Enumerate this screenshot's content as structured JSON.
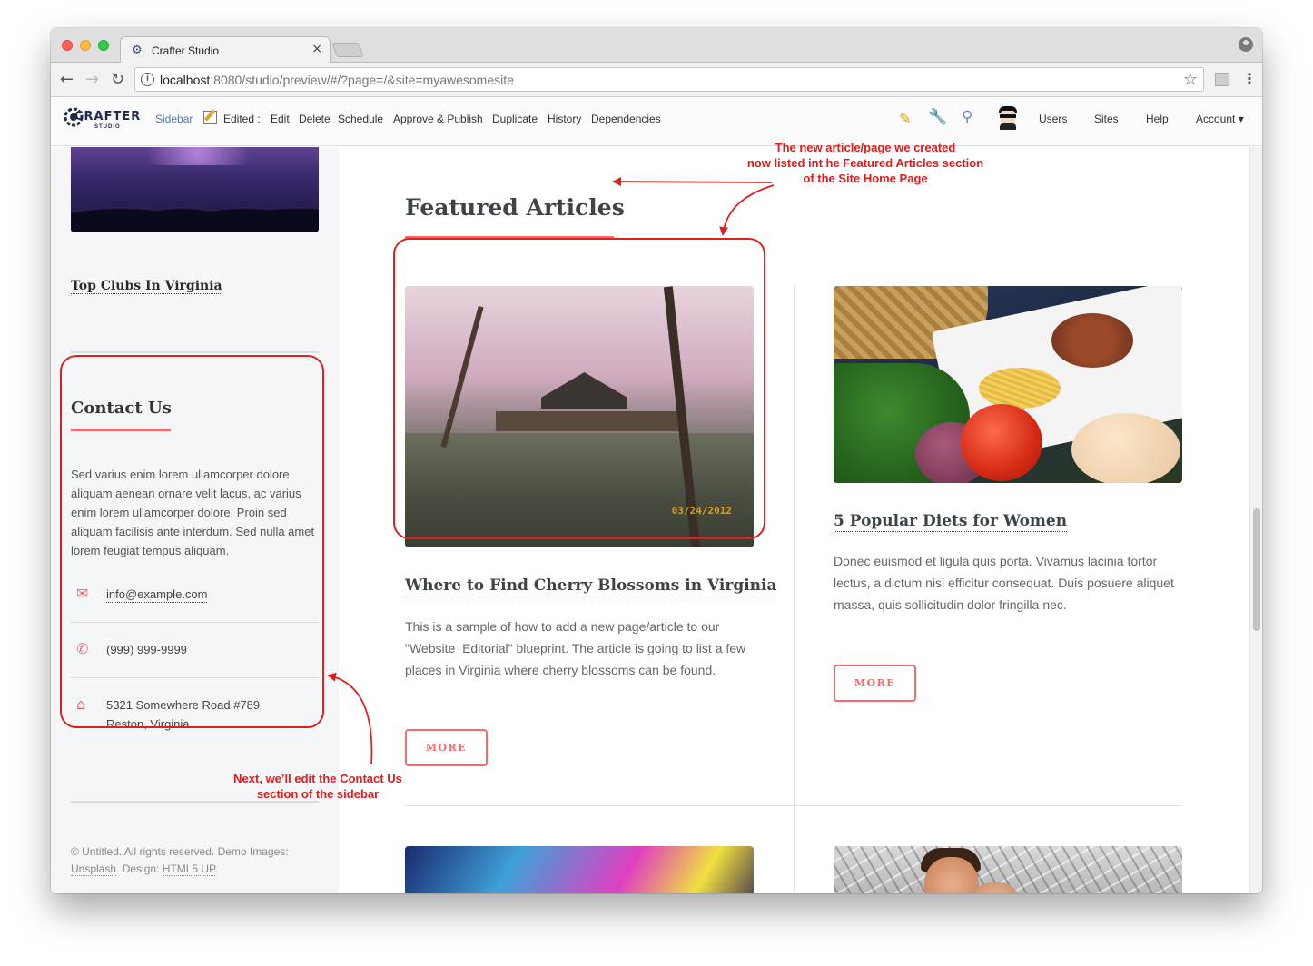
{
  "browser": {
    "tab_title": "Crafter Studio",
    "tab_close": "×",
    "url_host": "localhost",
    "url_rest": ":8080/studio/preview/#/?page=/&site=myawesomesite"
  },
  "studio_toolbar": {
    "logo_text": "CRAFTER",
    "logo_sub": "STUDIO",
    "sidebar": "Sidebar",
    "edited": "Edited :",
    "edit": "Edit",
    "delete": "Delete",
    "schedule": "Schedule",
    "approve_publish": "Approve & Publish",
    "duplicate": "Duplicate",
    "history": "History",
    "dependencies": "Dependencies",
    "users": "Users",
    "sites": "Sites",
    "help": "Help",
    "account": "Account ▾"
  },
  "sidebar": {
    "club_title": "Top Clubs In Virginia",
    "contact_title": "Contact Us",
    "contact_text": "Sed varius enim lorem ullamcorper dolore aliquam aenean ornare velit lacus, ac varius enim lorem ullamcorper dolore. Proin sed aliquam facilisis ante interdum. Sed nulla amet lorem feugiat tempus aliquam.",
    "email": "info@example.com",
    "phone": "(999) 999-9999",
    "address_line1": "5321 Somewhere Road #789",
    "address_line2": "Reston, Virginia",
    "copyright_prefix": "© Untitled. All rights reserved. Demo Images: ",
    "copyright_unsplash": "Unsplash",
    "copyright_mid": ". Design: ",
    "copyright_html5up": "HTML5 UP",
    "copyright_end": "."
  },
  "main": {
    "section_title": "Featured Articles",
    "articles": [
      {
        "title": "Where to Find Cherry Blossoms in Virginia",
        "body": "This is a sample of how to add a new page/article to our \"Website_Editorial\" blueprint. The article is going to list a few places in Virginia where cherry blossoms can be found.",
        "button": "MORE",
        "image_stamp": "03/24/2012"
      },
      {
        "title": "5 Popular Diets for Women",
        "body": "Donec euismod et ligula quis porta. Vivamus lacinia tortor lectus, a dictum nisi efficitur consequat. Duis posuere aliquet massa, quis sollicitudin dolor fringilla nec.",
        "button": "MORE"
      }
    ]
  },
  "annotations": {
    "top": "The new article/page we created\nnow listed int he Featured Articles section\nof the Site Home Page",
    "bottom": "Next, we’ll edit the Contact Us\nsection of the sidebar"
  },
  "colors": {
    "accent": "#f56a6a",
    "annotation": "#e02020"
  }
}
